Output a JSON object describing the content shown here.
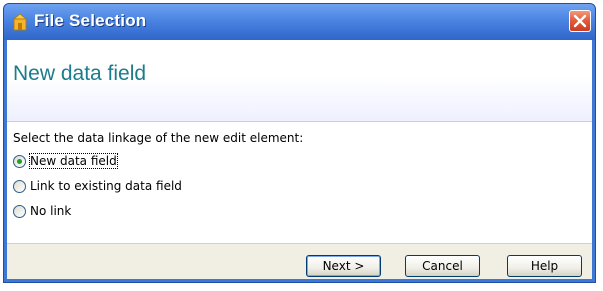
{
  "window": {
    "title": "File Selection",
    "icon": "app-folder-icon",
    "close_icon": "close-icon"
  },
  "header": {
    "title": "New data field"
  },
  "form": {
    "prompt": "Select the data linkage of the new edit element:",
    "options": [
      {
        "label": "New data field",
        "selected": true
      },
      {
        "label": "Link to existing data field",
        "selected": false
      },
      {
        "label": "No link",
        "selected": false
      }
    ]
  },
  "buttons": {
    "next": "Next >",
    "cancel": "Cancel",
    "help": "Help"
  },
  "colors": {
    "title_bar": "#3f78d4",
    "header_title": "#1c7c8c",
    "close_button": "#e2583b",
    "radio_selected": "#23a01f"
  }
}
